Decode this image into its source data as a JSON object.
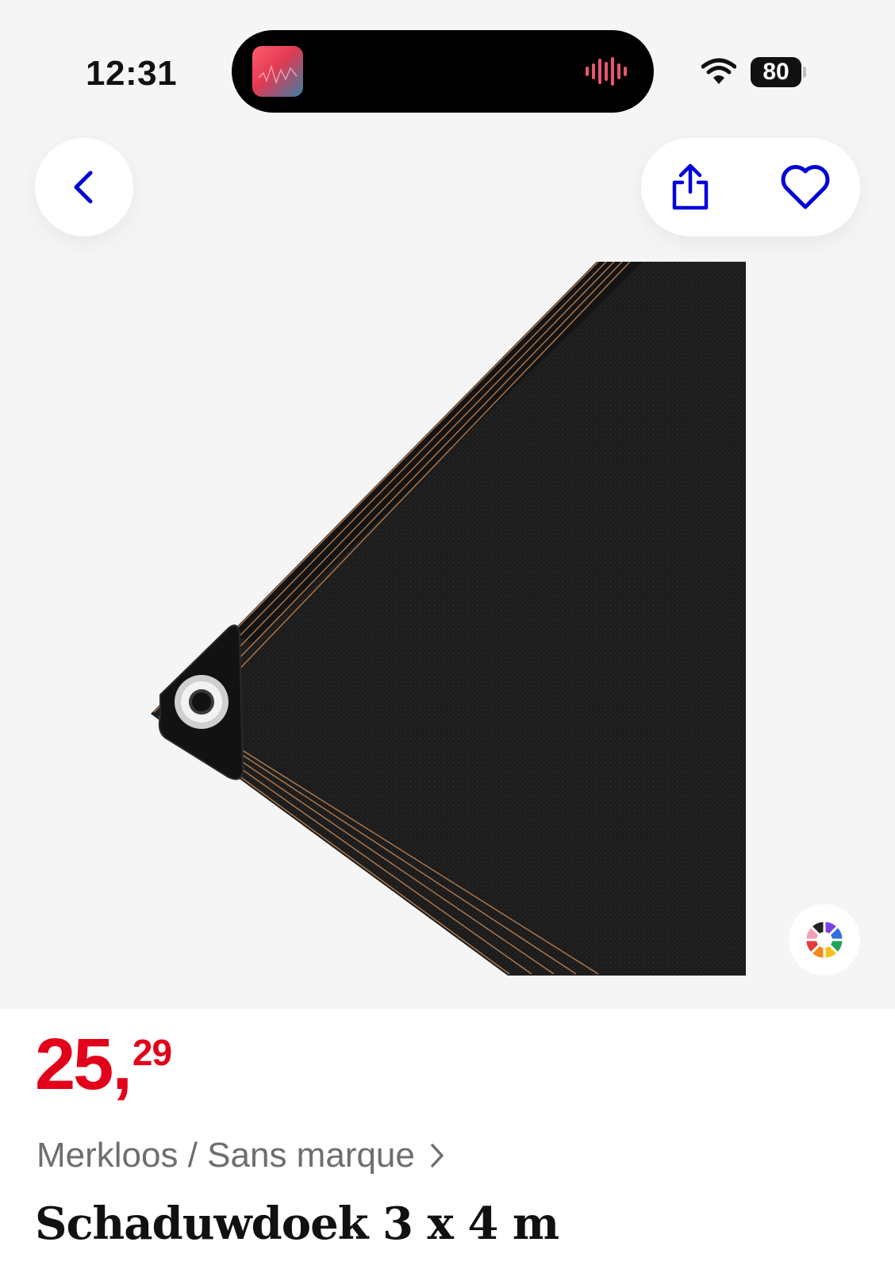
{
  "status_bar": {
    "time": "12:31",
    "battery": "80",
    "wifi_icon": "wifi-icon",
    "waveform_icon": "audio-waveform-icon"
  },
  "nav": {
    "back_icon": "chevron-left-icon",
    "share_icon": "share-icon",
    "favorite_icon": "heart-icon",
    "accent_color": "#0000d8"
  },
  "product": {
    "image_alt_icon": "shade-cloth-image",
    "color_picker_icon": "color-wheel-icon",
    "price_integer": "25",
    "price_separator": ",",
    "price_decimals": "29",
    "price_color": "#e2001a",
    "brand": "Merkloos / Sans marque",
    "title": "Schaduwdoek 3 x 4 m"
  }
}
